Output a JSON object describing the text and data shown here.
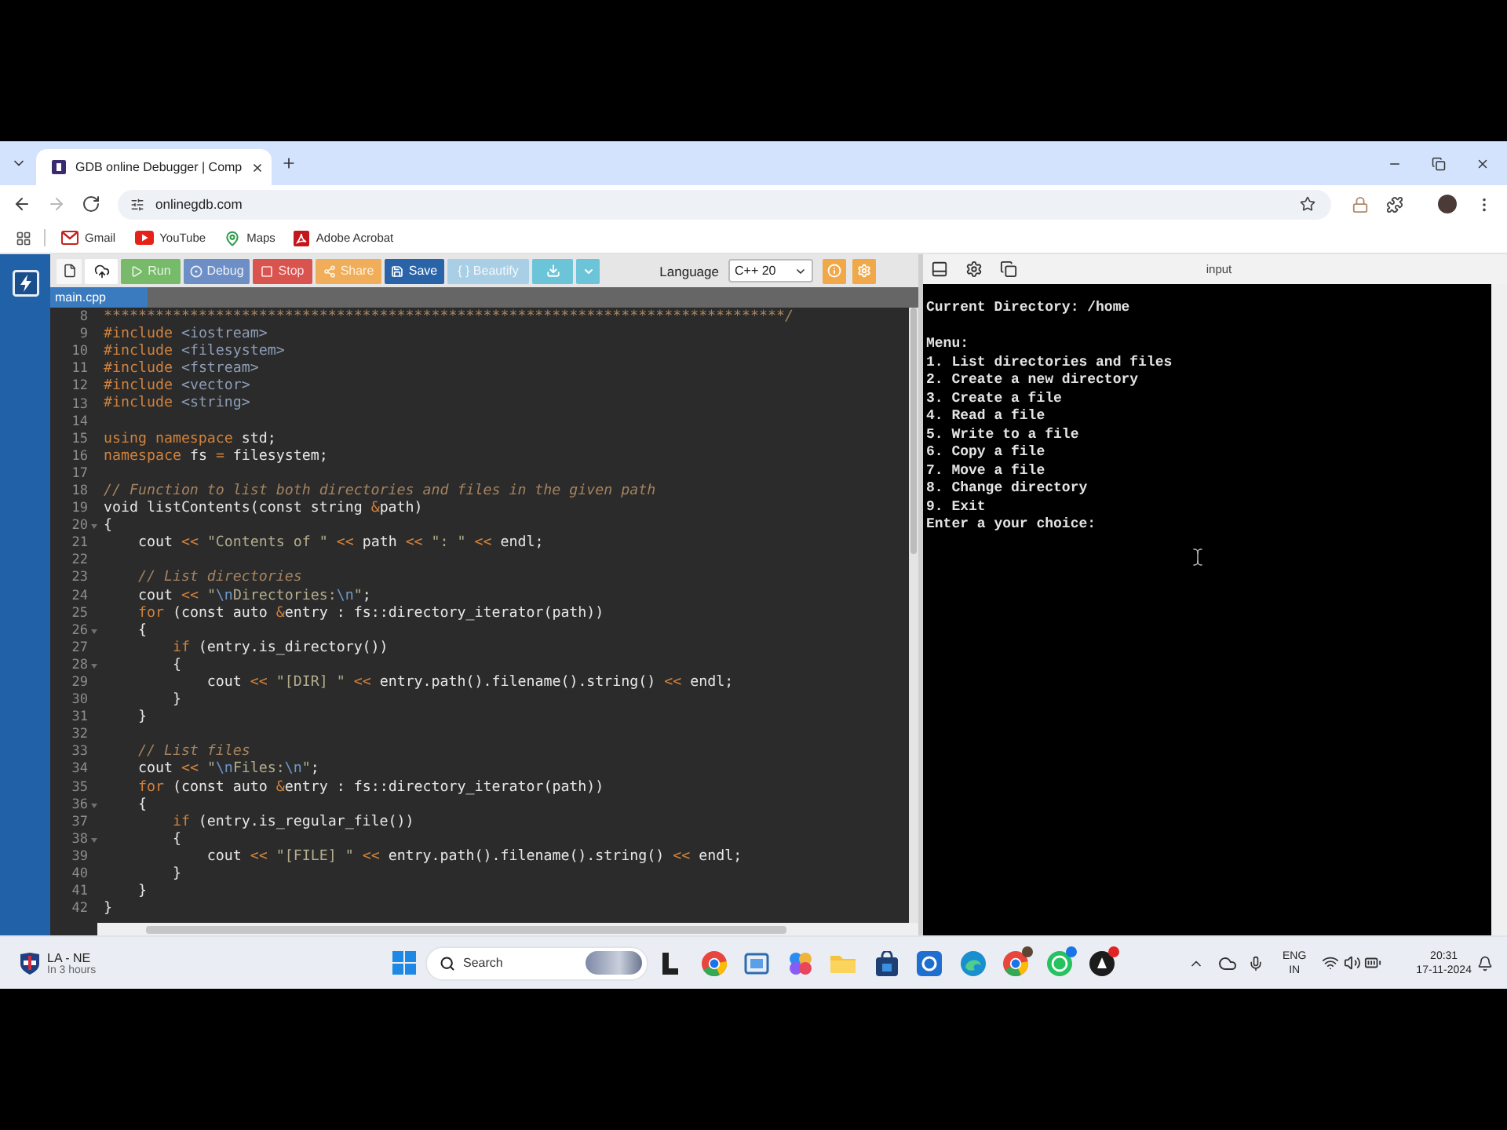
{
  "browser": {
    "tabs": [
      {
        "title": "GDB online Debugger | Comp",
        "selected": true
      }
    ],
    "nav": [
      {
        "kind": "back",
        "disabled": false
      },
      {
        "kind": "forward",
        "disabled": true
      },
      {
        "kind": "reload",
        "disabled": false
      }
    ],
    "address": "onlinegdb.com",
    "bookmarks": [
      {
        "kind": "gmail",
        "label": "Gmail"
      },
      {
        "kind": "youtube",
        "label": "YouTube"
      },
      {
        "kind": "maps",
        "label": "Maps"
      },
      {
        "kind": "acrobat",
        "label": "Adobe Acrobat"
      }
    ]
  },
  "toolbar": {
    "buttons": [
      {
        "kind": "run",
        "label": "Run"
      },
      {
        "kind": "debug",
        "label": "Debug"
      },
      {
        "kind": "stop",
        "label": "Stop"
      },
      {
        "kind": "share",
        "label": "Share"
      },
      {
        "kind": "save",
        "label": "Save"
      },
      {
        "kind": "beautify",
        "label": "{ } Beautify"
      }
    ],
    "language_label": "Language",
    "language": "C++ 20"
  },
  "file_tabs": [
    {
      "label": "main.cpp",
      "selected": true
    }
  ],
  "editor": {
    "lines": [
      {
        "number": "8",
        "fold": false,
        "tokens": [
          {
            "kind": "comment",
            "text": "*******************************************************************************/"
          }
        ]
      },
      {
        "number": "9",
        "fold": false,
        "tokens": [
          {
            "kind": "pre",
            "text": "#include "
          },
          {
            "kind": "header",
            "text": "<iostream>"
          }
        ]
      },
      {
        "number": "10",
        "fold": false,
        "tokens": [
          {
            "kind": "pre",
            "text": "#include "
          },
          {
            "kind": "header",
            "text": "<filesystem>"
          }
        ]
      },
      {
        "number": "11",
        "fold": false,
        "tokens": [
          {
            "kind": "pre",
            "text": "#include "
          },
          {
            "kind": "header",
            "text": "<fstream>"
          }
        ]
      },
      {
        "number": "12",
        "fold": false,
        "tokens": [
          {
            "kind": "pre",
            "text": "#include "
          },
          {
            "kind": "header",
            "text": "<vector>"
          }
        ]
      },
      {
        "number": "13",
        "fold": false,
        "tokens": [
          {
            "kind": "pre",
            "text": "#include "
          },
          {
            "kind": "header",
            "text": "<string>"
          }
        ]
      },
      {
        "number": "14",
        "fold": false
      },
      {
        "number": "15",
        "fold": false,
        "tokens": [
          {
            "kind": "kw",
            "text": "using namespace"
          },
          {
            "kind": "plain",
            "text": " std;"
          }
        ]
      },
      {
        "number": "16",
        "fold": false,
        "tokens": [
          {
            "kind": "kw",
            "text": "namespace"
          },
          {
            "kind": "plain",
            "text": " fs "
          },
          {
            "kind": "op",
            "text": "="
          },
          {
            "kind": "plain",
            "text": " filesystem;"
          }
        ]
      },
      {
        "number": "17",
        "fold": false
      },
      {
        "number": "18",
        "fold": false,
        "tokens": [
          {
            "kind": "comment",
            "text": "// Function to list both directories and files in the given path"
          }
        ]
      },
      {
        "number": "19",
        "fold": false,
        "tokens": [
          {
            "kind": "plain",
            "text": "void listContents(const string "
          },
          {
            "kind": "op",
            "text": "&"
          },
          {
            "kind": "plain",
            "text": "path)"
          }
        ]
      },
      {
        "number": "20",
        "fold": true,
        "tokens": [
          {
            "kind": "plain",
            "text": "{"
          }
        ]
      },
      {
        "number": "21",
        "fold": false,
        "tokens": [
          {
            "kind": "plain",
            "text": "    cout "
          },
          {
            "kind": "op",
            "text": "<< "
          },
          {
            "kind": "string",
            "text": "\"Contents of \" "
          },
          {
            "kind": "op",
            "text": "<<"
          },
          {
            "kind": "plain",
            "text": " path "
          },
          {
            "kind": "op",
            "text": "<< "
          },
          {
            "kind": "string",
            "text": "\": \" "
          },
          {
            "kind": "op",
            "text": "<<"
          },
          {
            "kind": "plain",
            "text": " endl;"
          }
        ]
      },
      {
        "number": "22",
        "fold": false
      },
      {
        "number": "23",
        "fold": false,
        "tokens": [
          {
            "kind": "comment",
            "text": "    // List directories"
          }
        ]
      },
      {
        "number": "24",
        "fold": false,
        "tokens": [
          {
            "kind": "plain",
            "text": "    cout "
          },
          {
            "kind": "op",
            "text": "<< "
          },
          {
            "kind": "string",
            "text": "\""
          },
          {
            "kind": "escape",
            "text": "\\n"
          },
          {
            "kind": "string",
            "text": "Directories:"
          },
          {
            "kind": "escape",
            "text": "\\n"
          },
          {
            "kind": "string",
            "text": "\""
          },
          {
            "kind": "plain",
            "text": ";"
          }
        ]
      },
      {
        "number": "25",
        "fold": false,
        "tokens": [
          {
            "kind": "kw",
            "text": "    for"
          },
          {
            "kind": "plain",
            "text": " (const auto "
          },
          {
            "kind": "op",
            "text": "&"
          },
          {
            "kind": "plain",
            "text": "entry : fs::directory_iterator(path))"
          }
        ]
      },
      {
        "number": "26",
        "fold": true,
        "tokens": [
          {
            "kind": "plain",
            "text": "    {"
          }
        ]
      },
      {
        "number": "27",
        "fold": false,
        "tokens": [
          {
            "kind": "kw",
            "text": "        if"
          },
          {
            "kind": "plain",
            "text": " (entry.is_directory())"
          }
        ]
      },
      {
        "number": "28",
        "fold": true,
        "tokens": [
          {
            "kind": "plain",
            "text": "        {"
          }
        ]
      },
      {
        "number": "29",
        "fold": false,
        "tokens": [
          {
            "kind": "plain",
            "text": "            cout "
          },
          {
            "kind": "op",
            "text": "<< "
          },
          {
            "kind": "string",
            "text": "\"[DIR] \" "
          },
          {
            "kind": "op",
            "text": "<<"
          },
          {
            "kind": "plain",
            "text": " entry.path().filename().string() "
          },
          {
            "kind": "op",
            "text": "<<"
          },
          {
            "kind": "plain",
            "text": " endl;"
          }
        ]
      },
      {
        "number": "30",
        "fold": false,
        "tokens": [
          {
            "kind": "plain",
            "text": "        }"
          }
        ]
      },
      {
        "number": "31",
        "fold": false,
        "tokens": [
          {
            "kind": "plain",
            "text": "    }"
          }
        ]
      },
      {
        "number": "32",
        "fold": false
      },
      {
        "number": "33",
        "fold": false,
        "tokens": [
          {
            "kind": "comment",
            "text": "    // List files"
          }
        ]
      },
      {
        "number": "34",
        "fold": false,
        "tokens": [
          {
            "kind": "plain",
            "text": "    cout "
          },
          {
            "kind": "op",
            "text": "<< "
          },
          {
            "kind": "string",
            "text": "\""
          },
          {
            "kind": "escape",
            "text": "\\n"
          },
          {
            "kind": "string",
            "text": "Files:"
          },
          {
            "kind": "escape",
            "text": "\\n"
          },
          {
            "kind": "string",
            "text": "\""
          },
          {
            "kind": "plain",
            "text": ";"
          }
        ]
      },
      {
        "number": "35",
        "fold": false,
        "tokens": [
          {
            "kind": "kw",
            "text": "    for"
          },
          {
            "kind": "plain",
            "text": " (const auto "
          },
          {
            "kind": "op",
            "text": "&"
          },
          {
            "kind": "plain",
            "text": "entry : fs::directory_iterator(path))"
          }
        ]
      },
      {
        "number": "36",
        "fold": true,
        "tokens": [
          {
            "kind": "plain",
            "text": "    {"
          }
        ]
      },
      {
        "number": "37",
        "fold": false,
        "tokens": [
          {
            "kind": "kw",
            "text": "        if"
          },
          {
            "kind": "plain",
            "text": " (entry.is_regular_file())"
          }
        ]
      },
      {
        "number": "38",
        "fold": true,
        "tokens": [
          {
            "kind": "plain",
            "text": "        {"
          }
        ]
      },
      {
        "number": "39",
        "fold": false,
        "tokens": [
          {
            "kind": "plain",
            "text": "            cout "
          },
          {
            "kind": "op",
            "text": "<< "
          },
          {
            "kind": "string",
            "text": "\"[FILE] \" "
          },
          {
            "kind": "op",
            "text": "<<"
          },
          {
            "kind": "plain",
            "text": " entry.path().filename().string() "
          },
          {
            "kind": "op",
            "text": "<<"
          },
          {
            "kind": "plain",
            "text": " endl;"
          }
        ]
      },
      {
        "number": "40",
        "fold": false,
        "tokens": [
          {
            "kind": "plain",
            "text": "        }"
          }
        ]
      },
      {
        "number": "41",
        "fold": false,
        "tokens": [
          {
            "kind": "plain",
            "text": "    }"
          }
        ]
      },
      {
        "number": "42",
        "fold": false,
        "tokens": [
          {
            "kind": "plain",
            "text": "}"
          }
        ]
      }
    ]
  },
  "output": {
    "label": "input",
    "current_directory": "Current Directory: /home",
    "menu": {
      "title": "Menu:",
      "items": [
        "1. List directories and files",
        "2. Create a new directory",
        "3. Create a file",
        "4. Read a file",
        "5. Write to a file",
        "6. Copy a file",
        "7. Move a file",
        "8. Change directory",
        "9. Exit"
      ]
    },
    "prompt": "Enter a your choice:"
  },
  "taskbar": {
    "widget": {
      "title": "LA - NE",
      "subtitle": "In 3 hours"
    },
    "search": {
      "placeholder": "Search"
    },
    "tray": {
      "language": "ENG",
      "region": "IN",
      "time": "20:31",
      "date": "17-11-2024"
    }
  }
}
